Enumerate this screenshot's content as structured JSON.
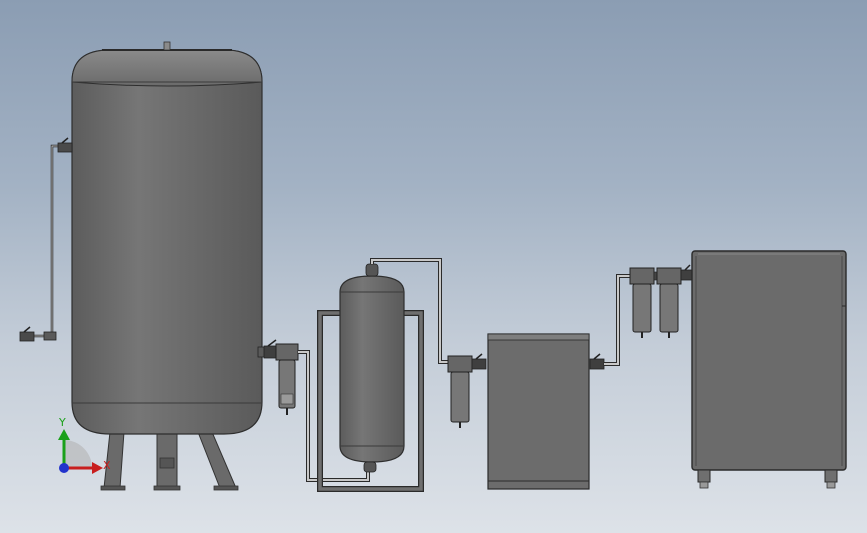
{
  "axes": {
    "y_label": "Y",
    "x_label": "X",
    "y_color": "#1aa01a",
    "x_color": "#c81e1e",
    "z_color": "#2233cc"
  },
  "colors": {
    "body": "#6e6e6e",
    "body_light": "#8a8a8a",
    "body_dark": "#555555",
    "outline": "#2e2e2e",
    "pipe": "#bdbdbd",
    "frame": "#707070"
  },
  "components": [
    "air-receiver-tank",
    "main-line-filter",
    "buffer-tank",
    "pre-filter",
    "refrigerated-dryer",
    "fine-filter-pair",
    "air-compressor"
  ]
}
